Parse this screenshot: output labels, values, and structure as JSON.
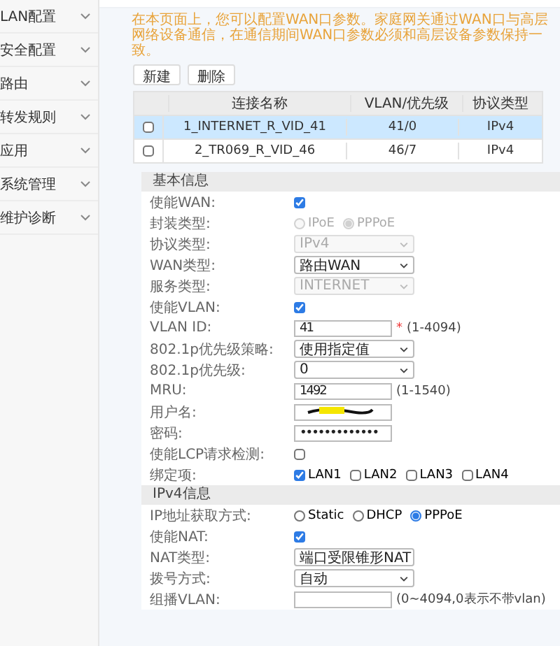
{
  "sidebar": {
    "items": [
      {
        "label": "LAN配置"
      },
      {
        "label": "安全配置"
      },
      {
        "label": "路由"
      },
      {
        "label": "转发规则"
      },
      {
        "label": "应用"
      },
      {
        "label": "系统管理"
      },
      {
        "label": "维护诊断"
      }
    ]
  },
  "notice": "在本页面上，您可以配置WAN口参数。家庭网关通过WAN口与高层网络设备通信，在通信期间WAN口参数必须和高层设备参数保持一致。",
  "buttons": [
    "新建",
    "删除"
  ],
  "table": {
    "columns": [
      "连接名称",
      "VLAN/优先级",
      "协议类型"
    ],
    "rows": [
      {
        "selected": true,
        "checked": false,
        "cells": [
          "1_INTERNET_R_VID_41",
          "41/0",
          "IPv4"
        ]
      },
      {
        "selected": false,
        "checked": false,
        "cells": [
          "2_TR069_R_VID_46",
          "46/7",
          "IPv4"
        ]
      }
    ]
  },
  "sections": [
    {
      "title": "基本信息",
      "fields": [
        {
          "kind": "checkbox",
          "label": "使能WAN:",
          "checked": true
        },
        {
          "kind": "radio",
          "label": "封装类型:",
          "disabled": true,
          "options": [
            {
              "label": "IPoE",
              "selected": false
            },
            {
              "label": "PPPoE",
              "selected": true
            }
          ]
        },
        {
          "kind": "select",
          "label": "协议类型:",
          "value": "IPv4",
          "disabled": true
        },
        {
          "kind": "select",
          "label": "WAN类型:",
          "value": "路由WAN",
          "disabled": false
        },
        {
          "kind": "select",
          "label": "服务类型:",
          "value": "INTERNET",
          "disabled": true
        },
        {
          "kind": "checkbox",
          "label": "使能VLAN:",
          "checked": true
        },
        {
          "kind": "input",
          "label": "VLAN ID:",
          "value": "41",
          "required": "*",
          "hint": "(1-4094)"
        },
        {
          "kind": "select",
          "label": "802.1p优先级策略:",
          "value": "使用指定值",
          "disabled": false
        },
        {
          "kind": "select",
          "label": "802.1p优先级:",
          "value": "0",
          "disabled": false
        },
        {
          "kind": "input",
          "label": "MRU:",
          "value": "1492",
          "hint": "(1-1540)"
        },
        {
          "kind": "input",
          "label": "用户名:",
          "redacted": true
        },
        {
          "kind": "input",
          "label": "密码:",
          "value": "•••••••••••••"
        },
        {
          "kind": "checkbox",
          "label": "使能LCP请求检测:",
          "checked": false
        },
        {
          "kind": "checkgroup",
          "label": "绑定项:",
          "options": [
            {
              "label": "LAN1",
              "checked": true
            },
            {
              "label": "LAN2",
              "checked": false
            },
            {
              "label": "LAN3",
              "checked": false
            },
            {
              "label": "LAN4",
              "checked": false
            }
          ]
        }
      ]
    },
    {
      "title": "IPv4信息",
      "fields": [
        {
          "kind": "radio",
          "label": "IP地址获取方式:",
          "disabled": false,
          "options": [
            {
              "label": "Static",
              "selected": false
            },
            {
              "label": "DHCP",
              "selected": false
            },
            {
              "label": "PPPoE",
              "selected": true
            }
          ]
        },
        {
          "kind": "checkbox",
          "label": "使能NAT:",
          "checked": true
        },
        {
          "kind": "select",
          "label": "NAT类型:",
          "value": "端口受限锥形NAT",
          "disabled": false
        },
        {
          "kind": "select",
          "label": "拨号方式:",
          "value": "自动",
          "disabled": false
        },
        {
          "kind": "input",
          "label": "组播VLAN:",
          "hint": "(0~4094,0表示不带vlan)"
        }
      ]
    }
  ]
}
